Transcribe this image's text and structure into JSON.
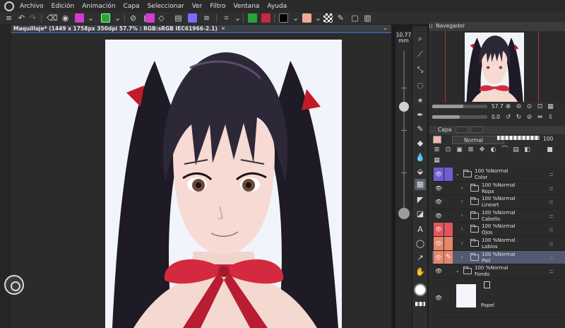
{
  "menubar": {
    "items": [
      "Archivo",
      "Edición",
      "Animación",
      "Capa",
      "Seleccionar",
      "Ver",
      "Filtro",
      "Ventana",
      "Ayuda"
    ],
    "logo_icon": "clip-studio-logo-icon"
  },
  "commandbar": {
    "accent_colors": {
      "green": "#2aa43a",
      "red": "#c8283c",
      "black": "#000000",
      "skin": "#f2a99a",
      "magenta": "#d53bd1",
      "purple": "#7b6bff"
    }
  },
  "document": {
    "tab_title": "Maquillaje* (1449 x 1758px 350dpi 57.7% : RGB:sRGB IEC61966-2.1)",
    "close_icon": "close-icon"
  },
  "brush": {
    "size_value": "10.77",
    "size_unit": "mm"
  },
  "navigator": {
    "title": "Navegador",
    "zoom_value": "57.7",
    "rotation_value": "0.0"
  },
  "layers_panel": {
    "title": "Capa",
    "blend_mode": "Normal",
    "opacity": "100",
    "layers": [
      {
        "line1": "100 %Normal",
        "line2": "Color",
        "indent": 0,
        "expanded": true,
        "selected": false,
        "color_tag": "#6c5dd3"
      },
      {
        "line1": "100 %Normal",
        "line2": "Ropa",
        "indent": 1,
        "expanded": false,
        "selected": false,
        "color_tag": ""
      },
      {
        "line1": "100 %Normal",
        "line2": "Lineart",
        "indent": 1,
        "expanded": false,
        "selected": false,
        "color_tag": ""
      },
      {
        "line1": "100 %Normal",
        "line2": "Cabello",
        "indent": 1,
        "expanded": false,
        "selected": false,
        "color_tag": ""
      },
      {
        "line1": "100 %Normal",
        "line2": "Ojos",
        "indent": 1,
        "expanded": false,
        "selected": false,
        "color_tag": "#e0555e"
      },
      {
        "line1": "100 %Normal",
        "line2": "Labios",
        "indent": 1,
        "expanded": false,
        "selected": false,
        "color_tag": "#e8866a"
      },
      {
        "line1": "100 %Normal",
        "line2": "Piel",
        "indent": 1,
        "expanded": false,
        "selected": true,
        "color_tag": "#e8866a"
      },
      {
        "line1": "100 %Normal",
        "line2": "Fondo",
        "indent": 0,
        "expanded": true,
        "selected": false,
        "color_tag": ""
      }
    ],
    "paper_layer": "Papel"
  }
}
